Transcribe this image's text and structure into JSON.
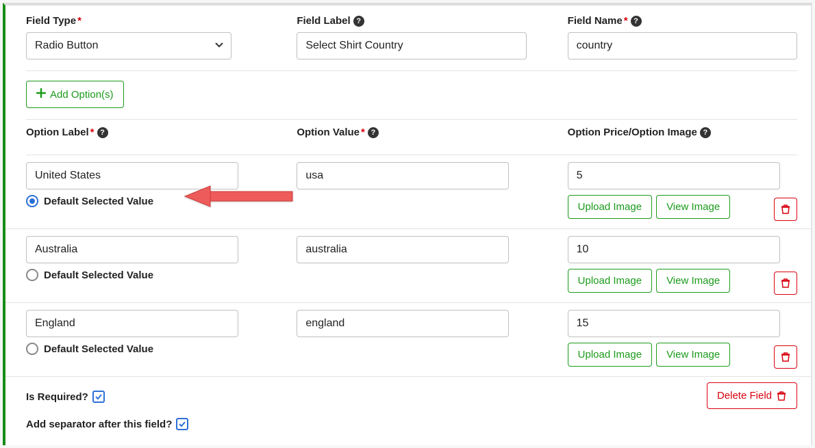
{
  "labels": {
    "field_type": "Field Type",
    "field_label": "Field Label",
    "field_name": "Field Name",
    "add_options": "Add Option(s)",
    "option_label": "Option Label",
    "option_value": "Option Value",
    "option_price": "Option Price/Option Image",
    "default_selected": "Default Selected Value",
    "upload_image": "Upload Image",
    "view_image": "View Image",
    "is_required": "Is Required?",
    "add_separator": "Add separator after this field?",
    "delete_field": "Delete Field"
  },
  "fields": {
    "field_type_value": "Radio Button",
    "field_label_value": "Select Shirt Country",
    "field_name_value": "country"
  },
  "options": [
    {
      "label": "United States",
      "value": "usa",
      "price": "5",
      "default": true
    },
    {
      "label": "Australia",
      "value": "australia",
      "price": "10",
      "default": false
    },
    {
      "label": "England",
      "value": "england",
      "price": "15",
      "default": false
    }
  ],
  "colors": {
    "green": "#1a9a1a",
    "red": "#d9000d",
    "blue": "#2b6fd6"
  }
}
